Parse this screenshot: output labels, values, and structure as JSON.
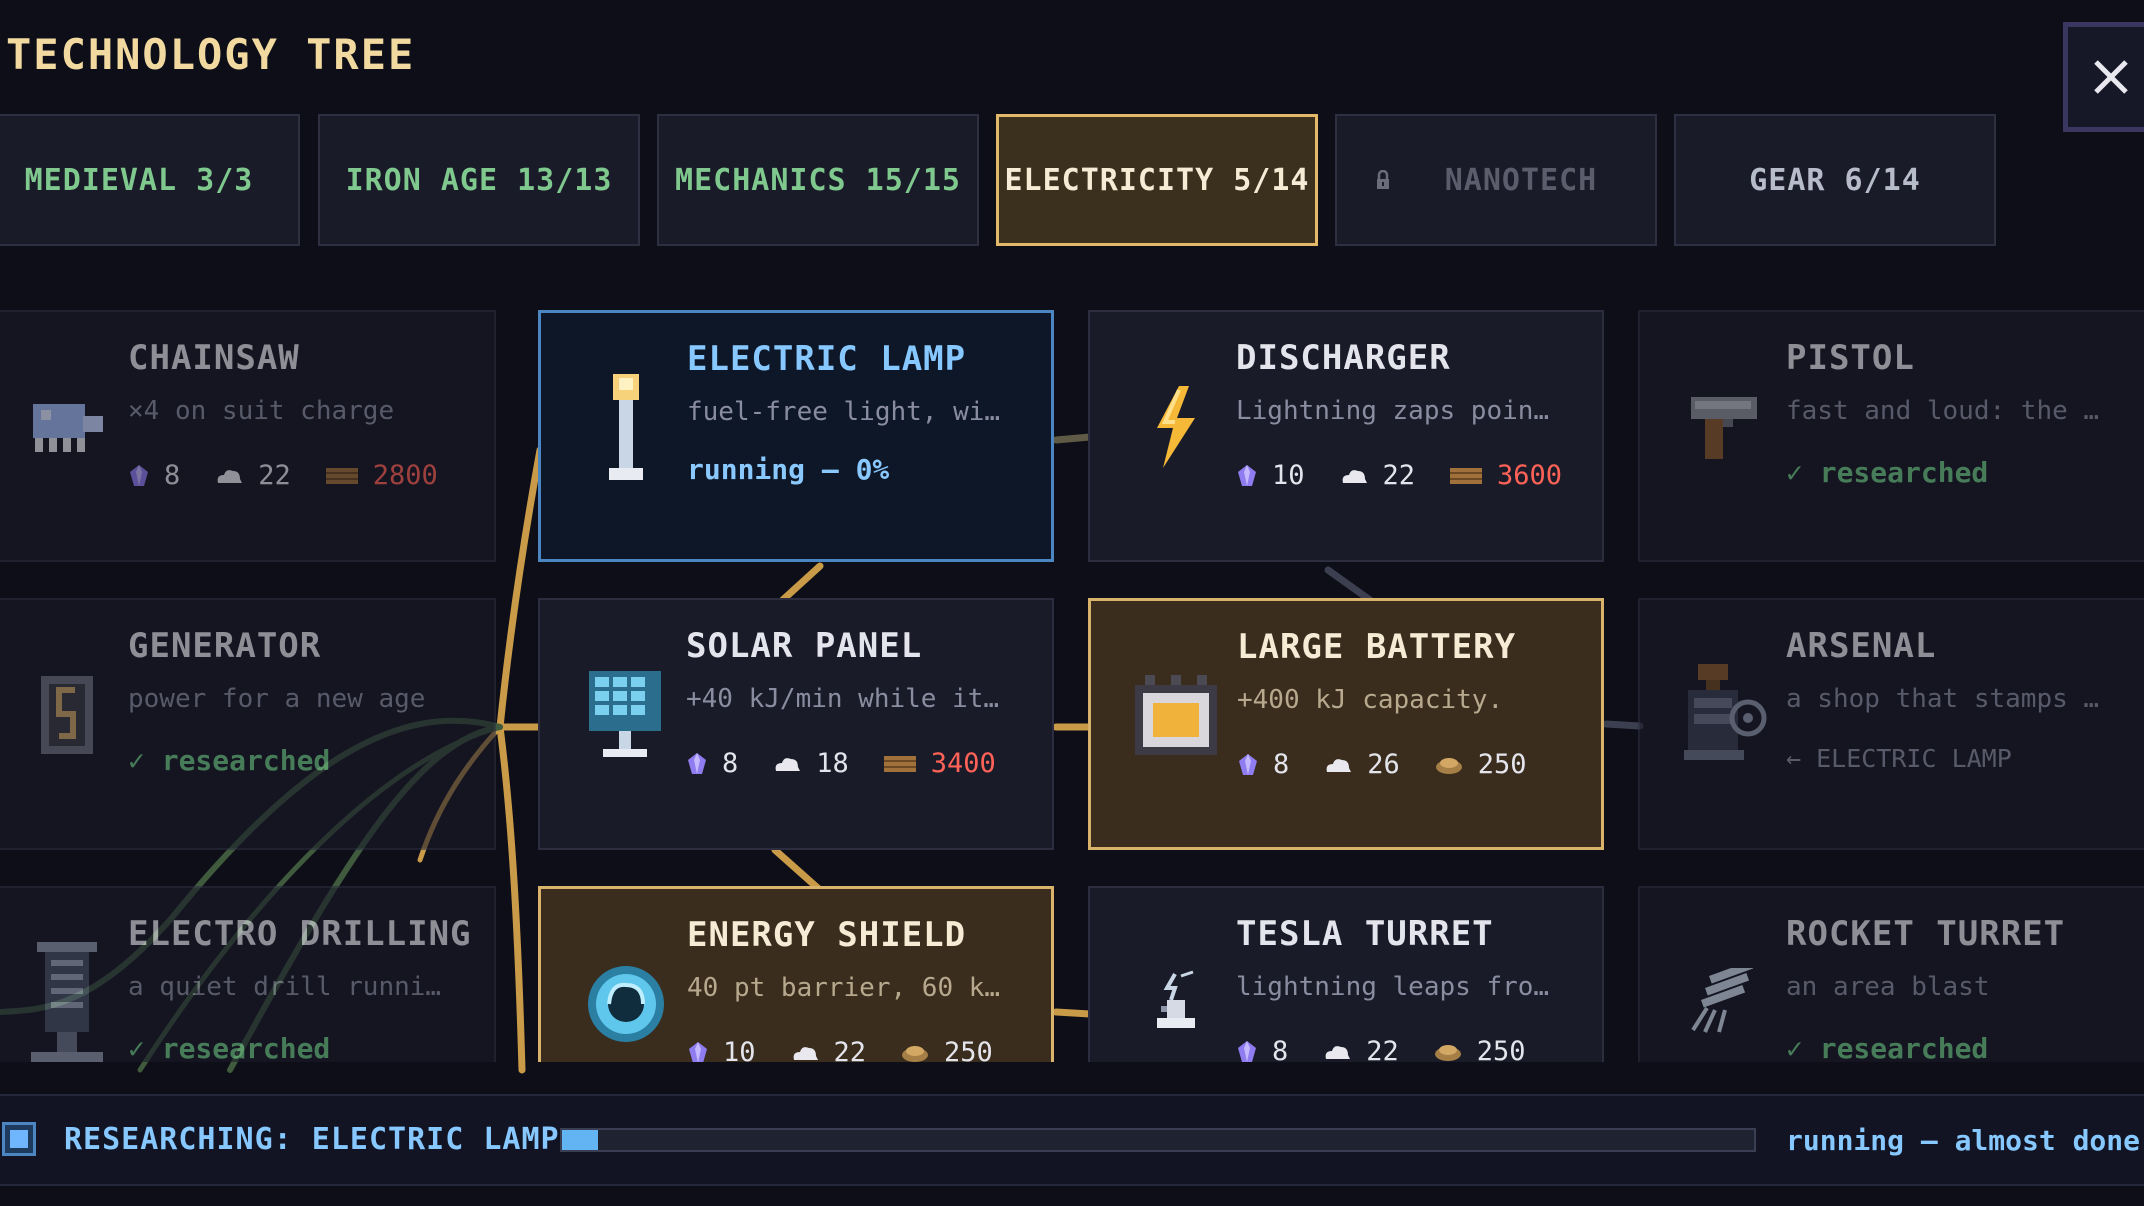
{
  "header": {
    "title": "TECHNOLOGY TREE",
    "close_icon": "close-icon"
  },
  "tabs": [
    {
      "label": "MEDIEVAL 3/3",
      "state": "complete"
    },
    {
      "label": "IRON AGE 13/13",
      "state": "complete"
    },
    {
      "label": "MECHANICS 15/15",
      "state": "complete"
    },
    {
      "label": "ELECTRICITY 5/14",
      "state": "active"
    },
    {
      "label": "NANOTECH",
      "state": "locked",
      "icon": "lock-icon"
    },
    {
      "label": "GEAR 6/14",
      "state": "open"
    }
  ],
  "techs": {
    "chainsaw": {
      "name": "CHAINSAW",
      "desc": "×4 on suit charge",
      "icon": "chainsaw-icon",
      "costs": [
        {
          "icon": "crystal-icon",
          "value": "8"
        },
        {
          "icon": "cloud-icon",
          "value": "22"
        },
        {
          "icon": "plank-icon",
          "value": "2800",
          "insufficient": true
        }
      ]
    },
    "electric_lamp": {
      "name": "ELECTRIC LAMP",
      "desc": "fuel-free light, wi…",
      "status": "running — 0%",
      "icon": "lamp-icon"
    },
    "discharger": {
      "name": "DISCHARGER",
      "desc": "Lightning zaps poin…",
      "icon": "lightning-icon",
      "costs": [
        {
          "icon": "crystal-icon",
          "value": "10"
        },
        {
          "icon": "cloud-icon",
          "value": "22"
        },
        {
          "icon": "plank-icon",
          "value": "3600",
          "insufficient": true
        }
      ]
    },
    "pistol": {
      "name": "PISTOL",
      "desc": "fast and loud: the …",
      "status": "✓ researched",
      "icon": "pistol-icon"
    },
    "generator": {
      "name": "GENERATOR",
      "desc": "power for a new age",
      "status": "✓ researched",
      "icon": "generator-icon"
    },
    "solar_panel": {
      "name": "SOLAR PANEL",
      "desc": "+40 kJ/min while it…",
      "icon": "solar-panel-icon",
      "costs": [
        {
          "icon": "crystal-icon",
          "value": "8"
        },
        {
          "icon": "cloud-icon",
          "value": "18"
        },
        {
          "icon": "plank-icon",
          "value": "3400",
          "insufficient": true
        }
      ]
    },
    "large_battery": {
      "name": "LARGE BATTERY",
      "desc": "+400 kJ capacity.",
      "icon": "battery-icon",
      "costs": [
        {
          "icon": "crystal-icon",
          "value": "8"
        },
        {
          "icon": "cloud-icon",
          "value": "26"
        },
        {
          "icon": "ore-icon",
          "value": "250"
        }
      ]
    },
    "arsenal": {
      "name": "ARSENAL",
      "desc": "a shop that stamps …",
      "status": "← ELECTRIC LAMP",
      "icon": "arsenal-icon"
    },
    "electro_drilling": {
      "name": "ELECTRO DRILLING",
      "desc": "a quiet drill runni…",
      "status": "✓ researched",
      "icon": "drill-icon"
    },
    "energy_shield": {
      "name": "ENERGY SHIELD",
      "desc": "40 pt barrier, 60 k…",
      "icon": "shield-icon",
      "costs": [
        {
          "icon": "crystal-icon",
          "value": "10"
        },
        {
          "icon": "cloud-icon",
          "value": "22"
        },
        {
          "icon": "ore-icon",
          "value": "250"
        }
      ]
    },
    "tesla_turret": {
      "name": "TESLA TURRET",
      "desc": "lightning leaps fro…",
      "icon": "tesla-turret-icon",
      "costs": [
        {
          "icon": "crystal-icon",
          "value": "8"
        },
        {
          "icon": "cloud-icon",
          "value": "22"
        },
        {
          "icon": "ore-icon",
          "value": "250"
        }
      ]
    },
    "rocket_turret": {
      "name": "ROCKET TURRET",
      "desc": "an area blast",
      "status": "✓ researched",
      "icon": "rocket-turret-icon"
    }
  },
  "research_bar": {
    "label": "RESEARCHING: ELECTRIC LAMP",
    "status": "running — almost done",
    "progress": 0.03
  },
  "colors": {
    "accent_gold": "#d9b26b",
    "accent_blue": "#4b86c3",
    "researched_green": "#6fc586",
    "insufficient_red": "#ff6257"
  }
}
